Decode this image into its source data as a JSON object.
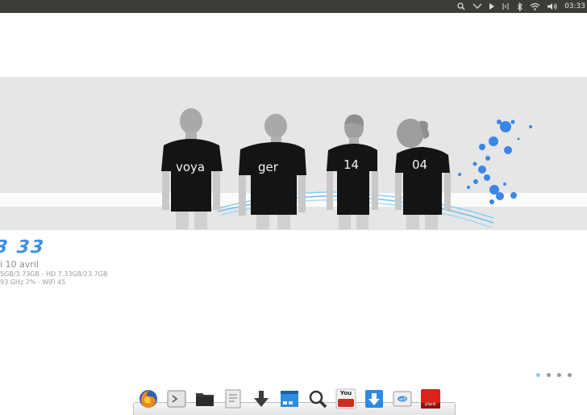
{
  "panel": {
    "clock": "03:33"
  },
  "wallpaper": {
    "shirts": [
      "voya",
      "ger",
      "14",
      "04"
    ],
    "colors": {
      "splash": "#3a86e8",
      "shirt": "#111111",
      "band": "#e6e6e6"
    }
  },
  "conky": {
    "time": "3 33",
    "date": "i 10 avril",
    "memory_line": "5GB/3.73GB - HD 7.33GB/23.7GB",
    "cpu_line": "93 GHz 2% - WiFi 45"
  },
  "workspaces": {
    "count": 4,
    "active_index": 0
  },
  "dock": {
    "items": [
      {
        "name": "firefox-icon"
      },
      {
        "name": "terminal-icon"
      },
      {
        "name": "files-icon"
      },
      {
        "name": "text-editor-icon"
      },
      {
        "name": "download-arrow-icon"
      },
      {
        "name": "desktop-icon"
      },
      {
        "name": "search-icon"
      },
      {
        "name": "youtube-icon",
        "label": "You\nTube"
      },
      {
        "name": "software-center-icon"
      },
      {
        "name": "network-icon"
      },
      {
        "name": "plank-icon",
        "label": "plank"
      }
    ]
  }
}
